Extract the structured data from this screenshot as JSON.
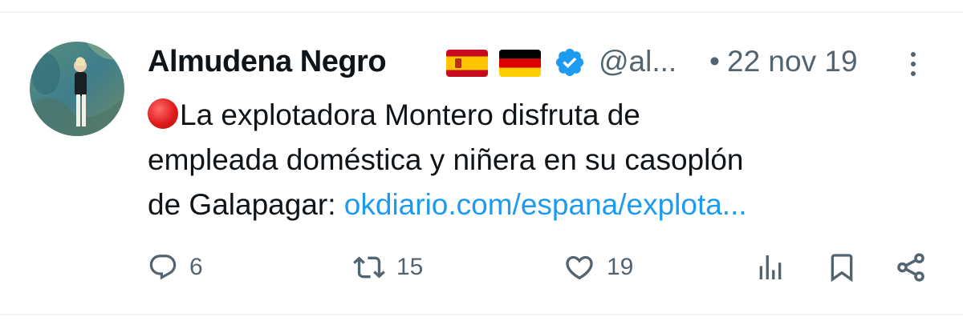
{
  "tweet": {
    "author_name": "Almudena Negro",
    "flags": [
      "spain-flag",
      "germany-flag"
    ],
    "verified": true,
    "handle": "@al...",
    "separator": "•",
    "date": "22 nov 19",
    "text": {
      "line1": "La explotadora Montero disfruta de",
      "line2": "empleada doméstica y niñera en su casoplón",
      "line3_prefix": "de Galapagar: ",
      "link": "okdiario.com/espana/explota..."
    },
    "stats": {
      "replies": "6",
      "retweets": "15",
      "likes": "19"
    }
  },
  "colors": {
    "text": "#0f1419",
    "secondary": "#536471",
    "link": "#1d9bf0",
    "verified": "#1d9bf0",
    "divider": "#eff3f4"
  }
}
